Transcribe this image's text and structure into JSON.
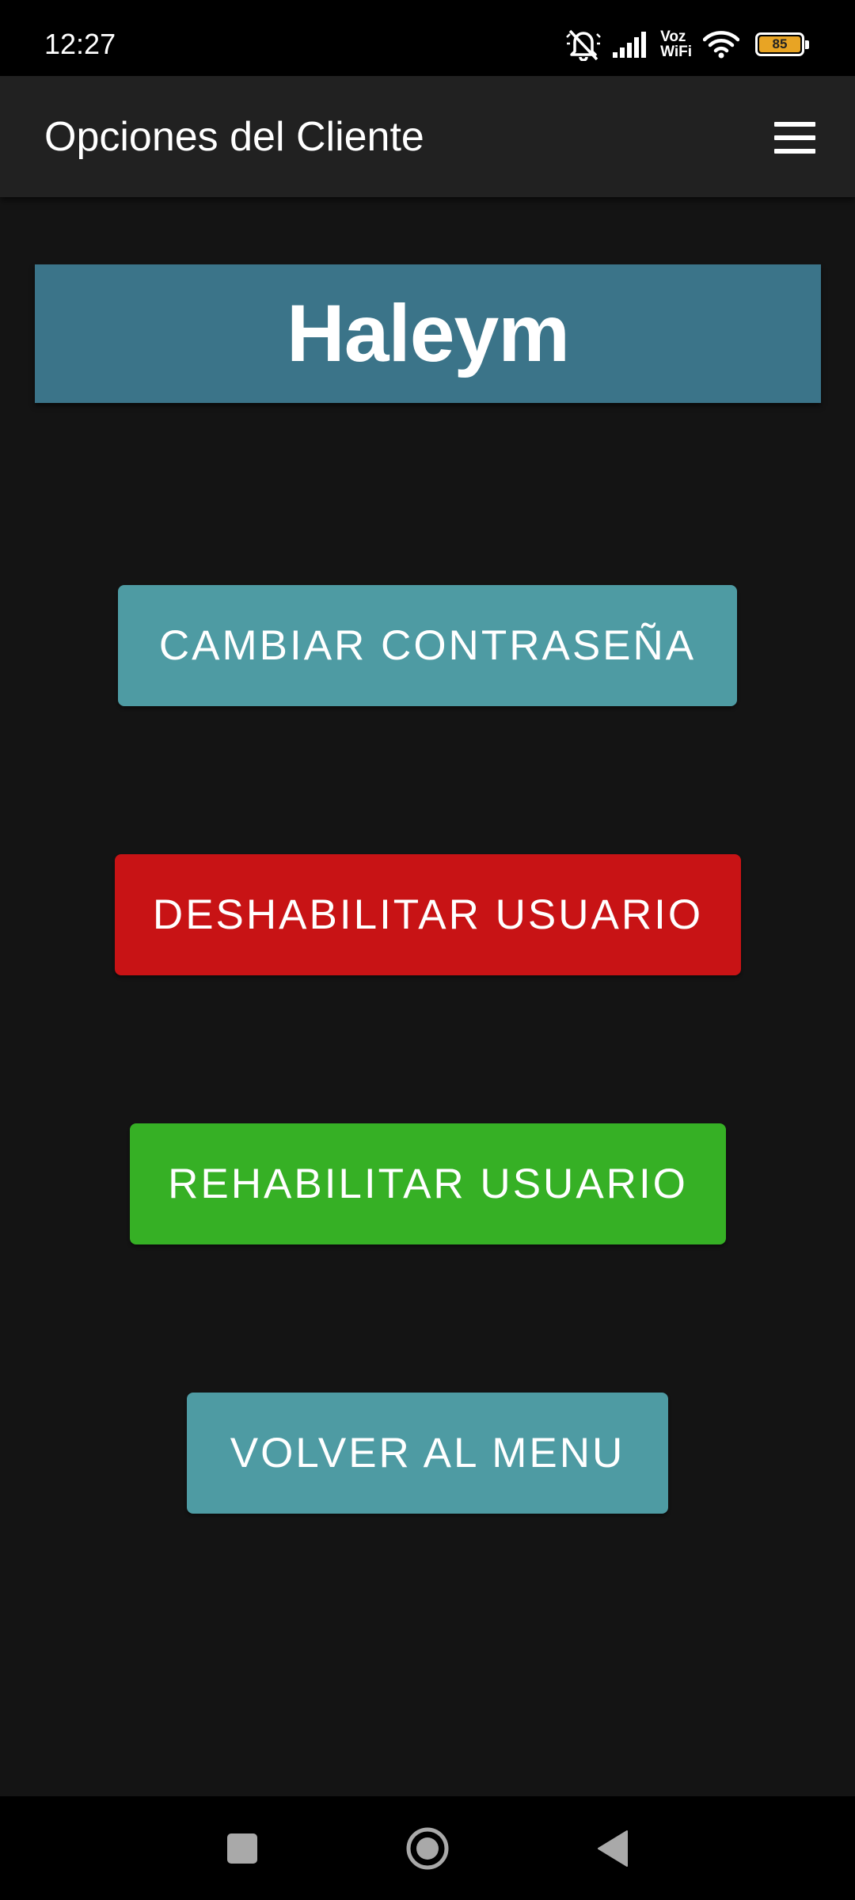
{
  "status_bar": {
    "time": "12:27",
    "network_label_top": "Voz",
    "network_label_bottom": "WiFi",
    "battery_level": "85",
    "battery_color": "#e8a424",
    "icons": [
      "mute-icon",
      "signal-icon",
      "wifi-icon",
      "battery-icon"
    ]
  },
  "app_bar": {
    "title": "Opciones del Cliente",
    "menu_icon": "hamburger-menu-icon"
  },
  "header": {
    "name": "Haleym",
    "background_color": "#3b7489"
  },
  "buttons": {
    "change_password": {
      "label": "CAMBIAR CONTRASEÑA",
      "color": "#4e9ba3"
    },
    "disable_user": {
      "label": "DESHABILITAR USUARIO",
      "color": "#c81315"
    },
    "enable_user": {
      "label": "REHABILITAR USUARIO",
      "color": "#36b025"
    },
    "back_to_menu": {
      "label": "VOLVER AL MENU",
      "color": "#4e9ba3"
    }
  },
  "nav_bar": {
    "icons": [
      "recents-icon",
      "home-icon",
      "back-icon"
    ]
  }
}
